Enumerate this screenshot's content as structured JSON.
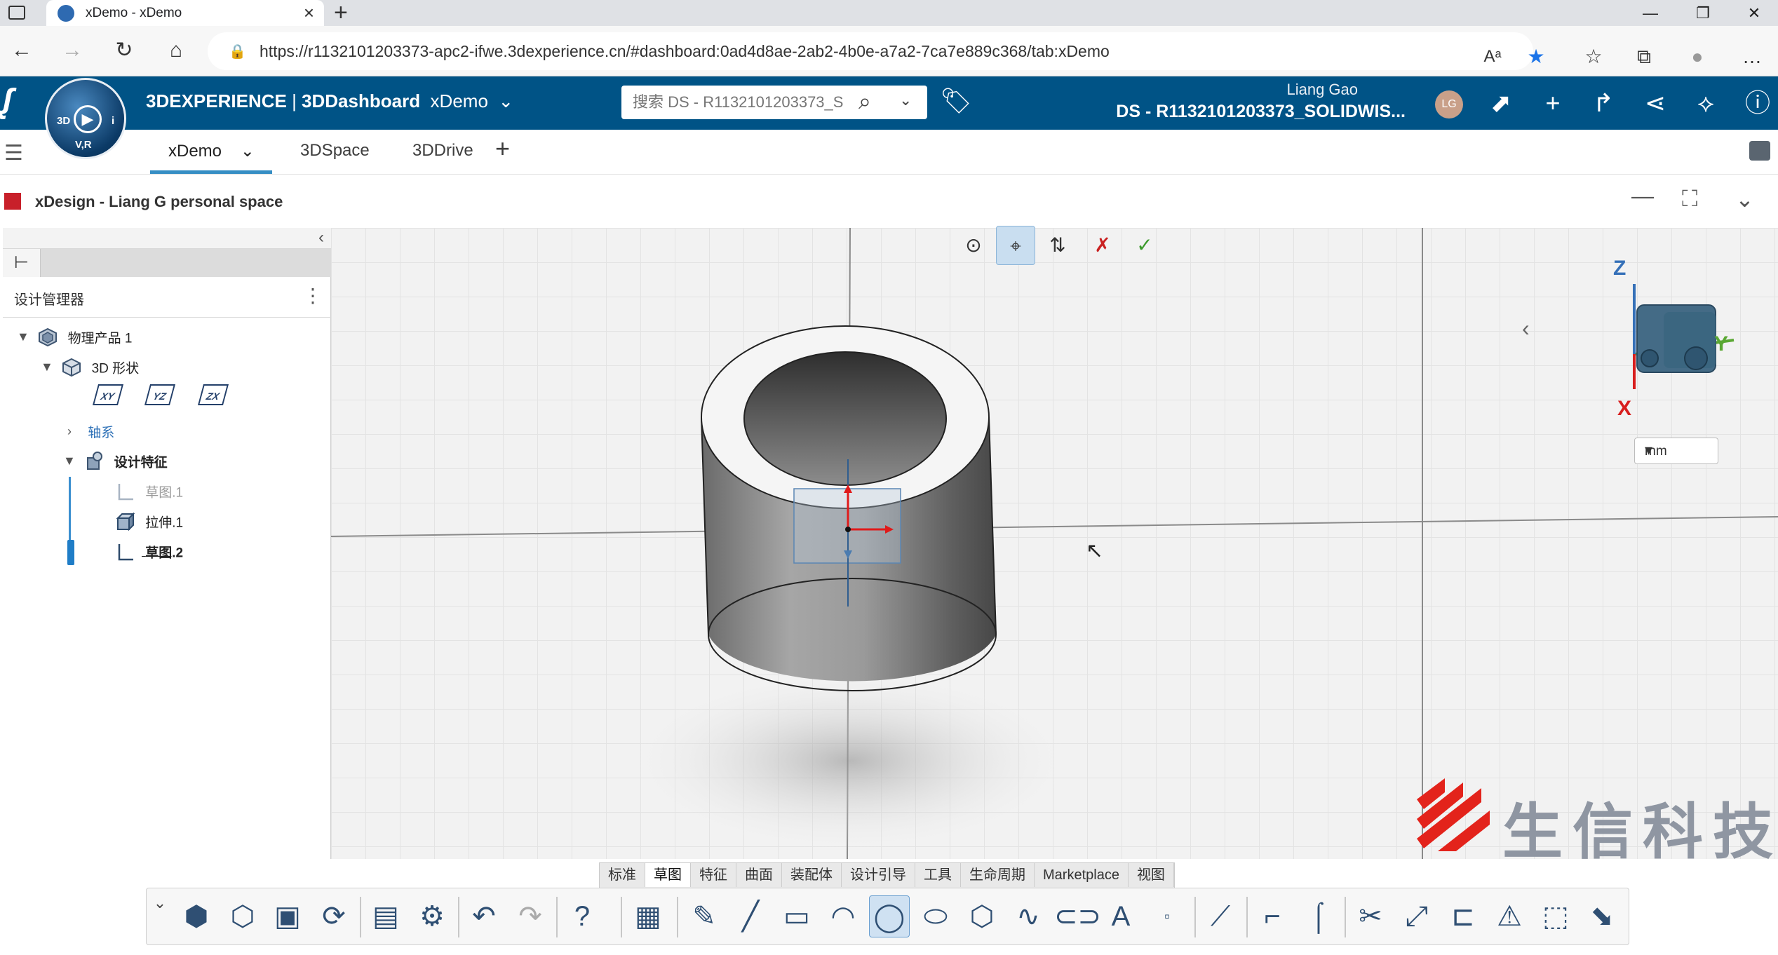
{
  "browser": {
    "tab_title": "xDemo - xDemo",
    "url": "https://r1132101203373-apc2-ifwe.3dexperience.cn/#dashboard:0ad4d8ae-2ab2-4b0e-a7a2-7ca7e889c368/tab:xDemo",
    "new_tab_symbol": "+",
    "min_symbol": "—",
    "max_symbol": "❐",
    "close_symbol": "✕"
  },
  "topbar": {
    "brand": "3DEXPERIENCE",
    "separator": " | ",
    "app": "3DDashboard",
    "dashboard_name": "xDemo",
    "search_placeholder": "搜索 DS - R1132101203373_S",
    "user_name": "Liang Gao",
    "tenant": "DS - R1132101203373_SOLIDWIS...",
    "avatar_initials": "LG",
    "compass_labels": {
      "top_left": "3D",
      "bottom": "V,R",
      "right": "i"
    }
  },
  "dashboard_tabs": [
    "xDemo",
    "3DSpace",
    "3DDrive"
  ],
  "widget": {
    "title": "xDesign - Liang G personal space"
  },
  "design_manager": {
    "title": "设计管理器",
    "tree": {
      "root": "物理产品 1",
      "shape": "3D 形状",
      "planes": [
        "XY",
        "YZ",
        "ZX"
      ],
      "axes": "轴系",
      "features": "设计特征",
      "items": [
        "草图.1",
        "拉伸.1",
        "草图.2"
      ]
    }
  },
  "canvas": {
    "axis_labels": {
      "z": "Z",
      "y": "Y",
      "x": "X"
    },
    "unit": "mm",
    "watermark_text": "生信科技"
  },
  "command_tabs": [
    "标准",
    "草图",
    "特征",
    "曲面",
    "装配体",
    "设计引导",
    "工具",
    "生命周期",
    "Marketplace",
    "视图"
  ],
  "active_command_tab": "草图",
  "colors": {
    "brand_blue": "#005386",
    "accent_blue": "#368ec4",
    "active_blue": "#cfe1f2"
  }
}
